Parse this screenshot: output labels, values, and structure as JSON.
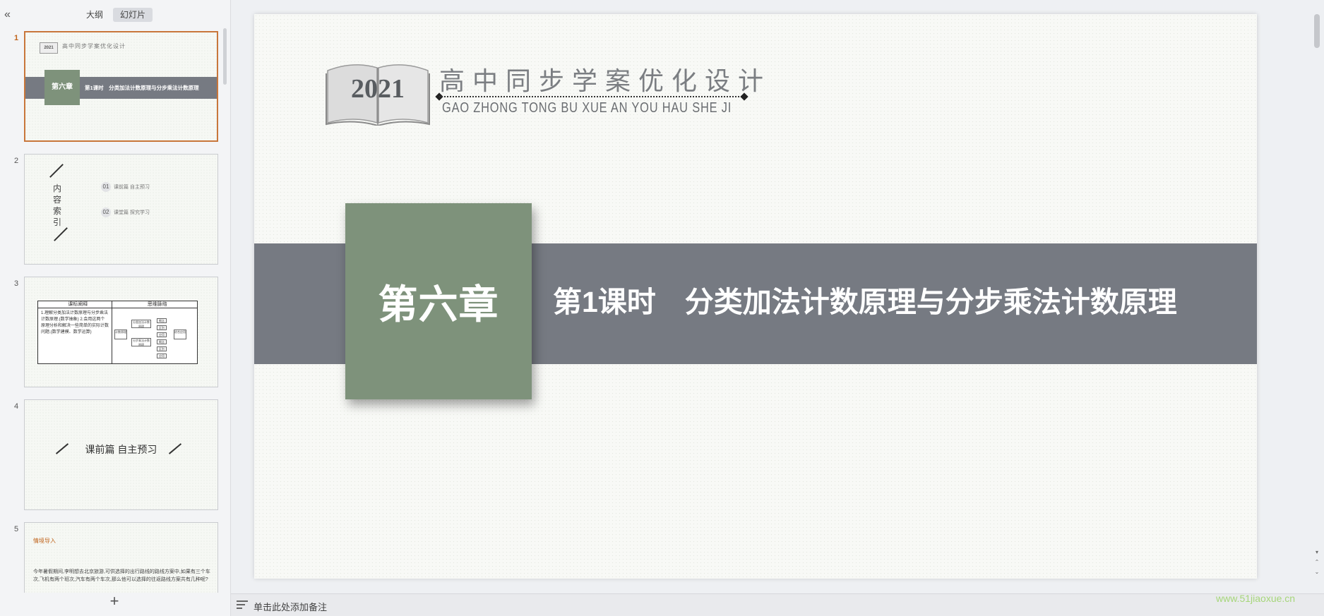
{
  "left_panel": {
    "collapse_icon": "«",
    "tabs": [
      {
        "label": "大纲",
        "active": false
      },
      {
        "label": "幻灯片",
        "active": true
      }
    ],
    "add_slide_icon": "+"
  },
  "thumbnails": [
    {
      "number": "1",
      "selected": true,
      "year": "2021",
      "title": "高中同步学案优化设计",
      "chapter": "第六章",
      "lesson": "第1课时　分类加法计数原理与分步乘法计数原理"
    },
    {
      "number": "2",
      "vertical_title": [
        "内",
        "容",
        "索",
        "引"
      ],
      "rows": [
        {
          "num": "01",
          "text": "课前篇  自主预习"
        },
        {
          "num": "02",
          "text": "课堂篇  探究学习"
        }
      ]
    },
    {
      "number": "3",
      "headers": [
        "课标阐释",
        "思维脉络"
      ],
      "text": "1.理解分类加法计数原理与分步乘法计数原理.(数学抽象)\n2.会用这两个原理分析和解决一些简单的实际计数问题.(数学建模、数学运算)",
      "boxes": [
        "计数原理",
        "分类加法计数原理",
        "分步乘法计数原理",
        "概念",
        "区别",
        "应用",
        "概念",
        "区别",
        "应用",
        "综合应用"
      ]
    },
    {
      "number": "4",
      "title": "课前篇  自主预习"
    },
    {
      "number": "5",
      "heading": "情境导入",
      "text": "今年暑假期间,李明想去北京旅游,可供选择的出行路线的路线方案中,如果有三个车次,飞机有两个班次,汽车有两个车次,那么他可以选择的往返路线方案共有几种呢?"
    }
  ],
  "slide": {
    "book_year": "2021",
    "brand_title": "高中同步学案优化设计",
    "brand_pinyin": "GAO ZHONG TONG BU XUE AN YOU HAU SHE JI",
    "chapter": "第六章",
    "lesson_title": "第1课时　分类加法计数原理与分步乘法计数原理",
    "colors": {
      "band": "#767a82",
      "chapter_box": "#7e927b",
      "selected_border": "#c8763a"
    }
  },
  "notes": {
    "placeholder": "单击此处添加备注"
  },
  "watermark": "www.51jiaoxue.cn"
}
